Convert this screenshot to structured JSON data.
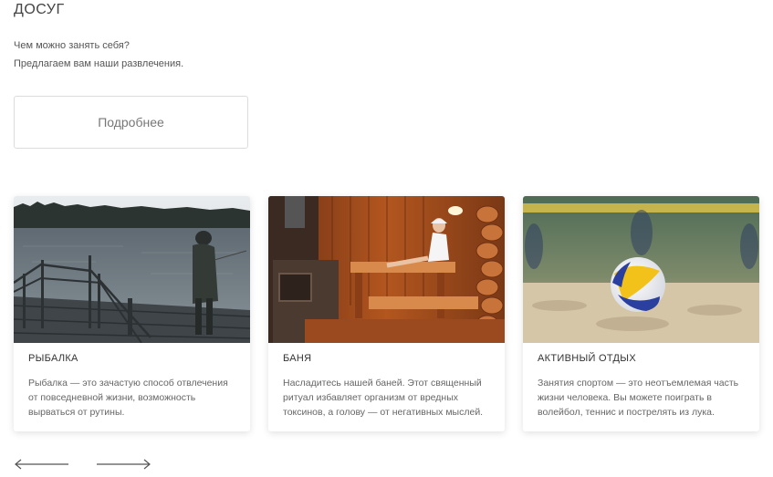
{
  "section": {
    "title": "ДОСУГ",
    "intro_line1": "Чем можно занять себя?",
    "intro_line2": "Предлагаем вам наши развлечения.",
    "more_button": "Подробнее"
  },
  "cards": [
    {
      "title": "РЫБАЛКА",
      "text": "Рыбалка — это зачастую способ отвлечения от повседневной жизни, возможность вырваться от рутины.",
      "image": "fisherman-on-pier-photo"
    },
    {
      "title": "БАНЯ",
      "text": "Насладитесь нашей баней. Этот священный ритуал избавляет организм от вредных токсинов, а голову — от негативных мыслей.",
      "image": "sauna-photo"
    },
    {
      "title": "АКТИВНЫЙ ОТДЫХ",
      "text": "Занятия спортом — это неотъемлемая часть жизни человека. Вы можете поиграть в волейбол, теннис и пострелять из лука.",
      "image": "beach-volleyball-photo"
    }
  ],
  "carousel": {
    "prev_icon": "arrow-left-icon",
    "next_icon": "arrow-right-icon"
  },
  "colors": {
    "text_dark": "#333333",
    "text_muted": "#666666",
    "border": "#dcdcdc"
  }
}
